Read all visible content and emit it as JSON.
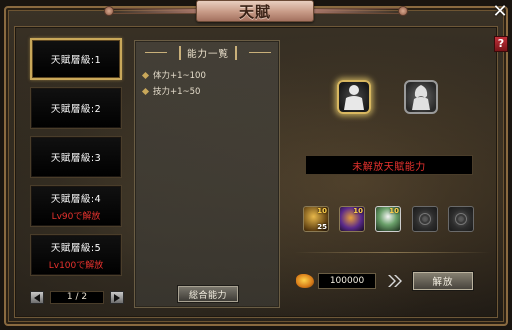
{
  "window": {
    "title": "天賦",
    "close_icon": "close-icon",
    "help_label": "?"
  },
  "tabs": [
    {
      "label": "天賦層級:1",
      "requirement": "",
      "active": true
    },
    {
      "label": "天賦層級:2",
      "requirement": "",
      "active": false
    },
    {
      "label": "天賦層級:3",
      "requirement": "",
      "active": false
    },
    {
      "label": "天賦層級:4",
      "requirement": "Lv90で解放",
      "active": false
    },
    {
      "label": "天賦層級:5",
      "requirement": "Lv100で解放",
      "active": false
    }
  ],
  "pager": {
    "page": "1 / 2"
  },
  "ability": {
    "header": "能力一覧",
    "stats": [
      {
        "name": "体力+1~100",
        "extra": ""
      },
      {
        "name": "技力+1~50",
        "extra": ""
      }
    ],
    "combined_button": "総合能力"
  },
  "talent": {
    "status_text": "未解放天賦能力",
    "skills": [
      {
        "top": "10",
        "count": "25"
      },
      {
        "top": "10",
        "count": ""
      },
      {
        "top": "10",
        "count": ""
      },
      {
        "top": "",
        "count": ""
      },
      {
        "top": "",
        "count": ""
      }
    ]
  },
  "cost": {
    "amount": "100000",
    "release_button": "解放"
  },
  "colors": {
    "accent_gold": "#c9a85a",
    "warning_red": "#e8322e"
  }
}
